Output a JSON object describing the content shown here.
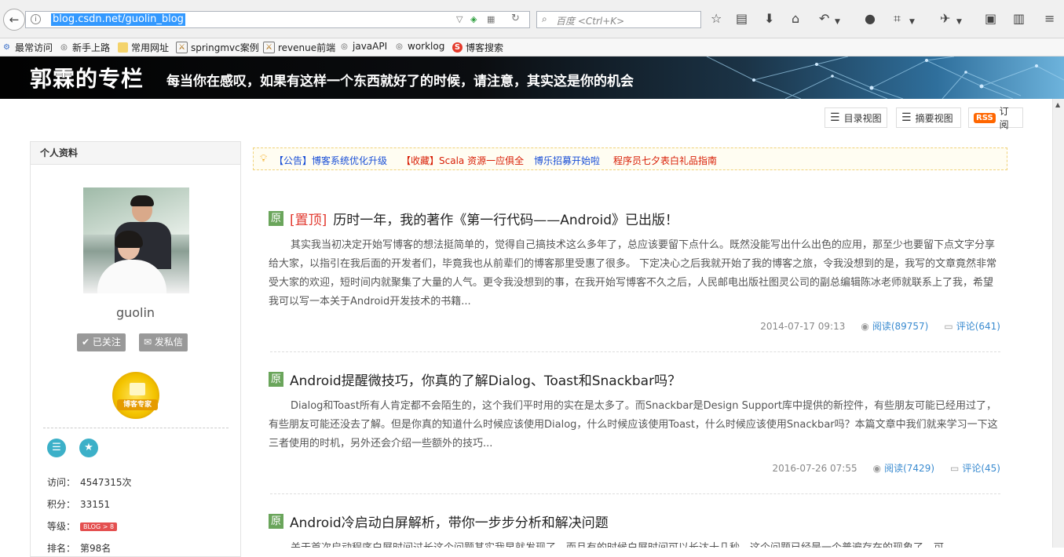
{
  "browser": {
    "url": "blog.csdn.net/guolin_blog",
    "search_placeholder": "百度 <Ctrl+K>",
    "back_icon": "back-arrow-icon",
    "info_icon": "info-icon"
  },
  "bookmarks": [
    {
      "label": "最常访问",
      "icon": "gear-icon"
    },
    {
      "label": "新手上路",
      "icon": "globe-icon"
    },
    {
      "label": "常用网址",
      "icon": "folder-icon"
    },
    {
      "label": "springmvc案例",
      "icon": "image-icon"
    },
    {
      "label": "revenue前端",
      "icon": "image-icon"
    },
    {
      "label": "javaAPI",
      "icon": "globe-icon"
    },
    {
      "label": "worklog",
      "icon": "globe-icon"
    },
    {
      "label": "博客搜索",
      "icon": "csdn-s-icon"
    }
  ],
  "banner": {
    "title": "郭霖的专栏",
    "subtitle": "每当你在感叹，如果有这样一个东西就好了的时候，请注意，其实这是你的机会"
  },
  "view_buttons": {
    "catalog": "目录视图",
    "summary": "摘要视图",
    "rss_badge": "RSS",
    "subscribe": "订阅"
  },
  "profile": {
    "heading": "个人资料",
    "username": "guolin",
    "followed_label": "已关注",
    "message_label": "发私信",
    "medal_text": "博客专家",
    "stats": [
      {
        "label": "访问：",
        "value": "4547315次"
      },
      {
        "label": "积分：",
        "value": "33151"
      },
      {
        "label": "等级：",
        "value": "BLOG > 8"
      },
      {
        "label": "排名：",
        "value": "第98名"
      }
    ]
  },
  "notices": [
    {
      "text": "【公告】博客系统优化升级",
      "color": "#1a4fd6"
    },
    {
      "text": "【收藏】Scala 资源一应俱全",
      "color": "#d81e06"
    },
    {
      "text": "博乐招募开始啦",
      "color": "#1a4fd6"
    },
    {
      "text": "程序员七夕表白礼品指南",
      "color": "#d81e06"
    }
  ],
  "articles": [
    {
      "badge": "原",
      "pinned": "[置顶]",
      "title": "历时一年，我的著作《第一行代码——Android》已出版！",
      "summary": "其实我当初决定开始写博客的想法挺简单的，觉得自己搞技术这么多年了，总应该要留下点什么。既然没能写出什么出色的应用，那至少也要留下点文字分享给大家，以指引在我后面的开发者们，毕竟我也从前辈们的博客那里受惠了很多。 下定决心之后我就开始了我的博客之旅，令我没想到的是，我写的文章竟然非常受大家的欢迎，短时间内就聚集了大量的人气。更令我没想到的事，在我开始写博客不久之后，人民邮电出版社图灵公司的副总编辑陈冰老师就联系上了我，希望我可以写一本关于Android开发技术的书籍...",
      "date": "2014-07-17 09:13",
      "read": "阅读(89757)",
      "comments": "评论(641)"
    },
    {
      "badge": "原",
      "pinned": "",
      "title": "Android提醒微技巧，你真的了解Dialog、Toast和Snackbar吗？",
      "summary": "Dialog和Toast所有人肯定都不会陌生的，这个我们平时用的实在是太多了。而Snackbar是Design Support库中提供的新控件，有些朋友可能已经用过了，有些朋友可能还没去了解。但是你真的知道什么时候应该使用Dialog，什么时候应该使用Toast，什么时候应该使用Snackbar吗？本篇文章中我们就来学习一下这三者使用的时机，另外还会介绍一些额外的技巧...",
      "date": "2016-07-26 07:55",
      "read": "阅读(7429)",
      "comments": "评论(45)"
    },
    {
      "badge": "原",
      "pinned": "",
      "title": "Android冷启动白屏解析，带你一步步分析和解决问题",
      "summary": "关于首次启动程序白屏时间过长这个问题其实我早就发现了，而且有的时候白屏时间可以长达十几秒，这个问题已经是一个普遍存在的现象了，可",
      "date": "",
      "read": "",
      "comments": ""
    }
  ]
}
